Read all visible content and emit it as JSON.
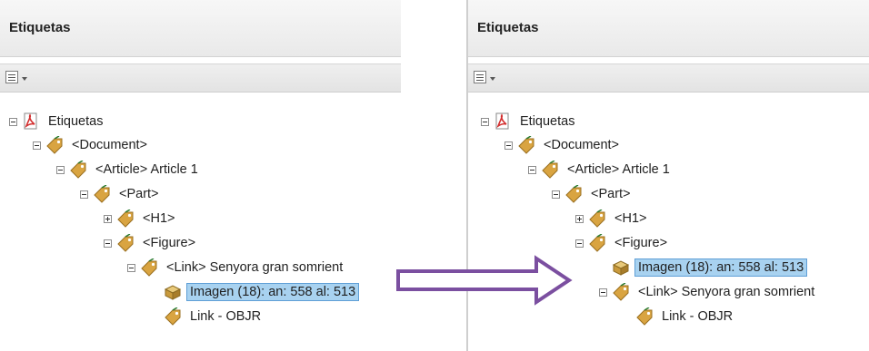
{
  "left_panel": {
    "title": "Etiquetas",
    "tree": [
      {
        "label": "Etiquetas",
        "icon": "pdf-icon",
        "expander": "expanded",
        "selected": false
      },
      {
        "label": "<Document>",
        "icon": "tag-icon",
        "expander": "expanded",
        "selected": false
      },
      {
        "label": "<Article> Article 1",
        "icon": "tag-icon",
        "expander": "expanded",
        "selected": false
      },
      {
        "label": "<Part>",
        "icon": "tag-icon",
        "expander": "expanded",
        "selected": false
      },
      {
        "label": "<H1>",
        "icon": "tag-icon",
        "expander": "collapsed",
        "selected": false
      },
      {
        "label": "<Figure>",
        "icon": "tag-icon",
        "expander": "expanded",
        "selected": false
      },
      {
        "label": "<Link> Senyora gran somrient",
        "icon": "tag-icon",
        "expander": "expanded",
        "selected": false
      },
      {
        "label": "Imagen (18): an: 558 al: 513",
        "icon": "image-content-icon",
        "expander": "none",
        "selected": true
      },
      {
        "label": "Link - OBJR",
        "icon": "tag-icon",
        "expander": "none",
        "selected": false
      }
    ]
  },
  "right_panel": {
    "title": "Etiquetas",
    "tree": [
      {
        "label": "Etiquetas",
        "icon": "pdf-icon",
        "expander": "expanded",
        "selected": false
      },
      {
        "label": "<Document>",
        "icon": "tag-icon",
        "expander": "expanded",
        "selected": false
      },
      {
        "label": "<Article> Article 1",
        "icon": "tag-icon",
        "expander": "expanded",
        "selected": false
      },
      {
        "label": "<Part>",
        "icon": "tag-icon",
        "expander": "expanded",
        "selected": false
      },
      {
        "label": "<H1>",
        "icon": "tag-icon",
        "expander": "collapsed",
        "selected": false
      },
      {
        "label": "<Figure>",
        "icon": "tag-icon",
        "expander": "expanded",
        "selected": false
      },
      {
        "label": "Imagen (18): an: 558 al: 513",
        "icon": "image-content-icon",
        "expander": "none",
        "selected": true
      },
      {
        "label": "<Link> Senyora gran somrient",
        "icon": "tag-icon",
        "expander": "expanded",
        "selected": false
      },
      {
        "label": "Link - OBJR",
        "icon": "tag-icon",
        "expander": "none",
        "selected": false
      }
    ]
  },
  "toolbar_icon": "options-menu-icon",
  "annotation": {
    "icon": "move-arrow-icon",
    "color": "#7b4fa0"
  },
  "colors": {
    "selection": "#a8d2f0",
    "tag_icon": "#d9a441",
    "pdf_icon": "#d32f2f"
  }
}
